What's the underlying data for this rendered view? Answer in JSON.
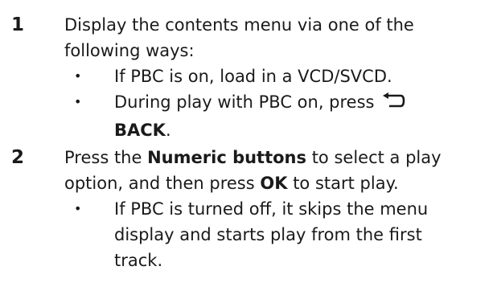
{
  "steps": [
    {
      "number": "1",
      "text": "Display the contents menu via one of the following ways:",
      "line1": "Display the contents menu via one of the",
      "line2": "following ways:",
      "bullets": [
        {
          "bullet": "•",
          "text": "If PBC is on, load in a VCD/SVCD."
        },
        {
          "bullet": "•",
          "prefix": "During play with PBC on, press",
          "icon": "back-arrow-icon",
          "bold": "BACK",
          "suffix": "."
        }
      ]
    },
    {
      "number": "2",
      "pre": "Press the",
      "bold1": "Numeric buttons",
      "mid": "to select a play",
      "line2_pre": "option, and then press",
      "bold2": "OK",
      "line2_post": "to start play.",
      "bullets": [
        {
          "bullet": "•",
          "line1": "If PBC is turned off, it skips the menu",
          "line2": "display and starts play from the first",
          "line3": "track."
        }
      ]
    }
  ]
}
